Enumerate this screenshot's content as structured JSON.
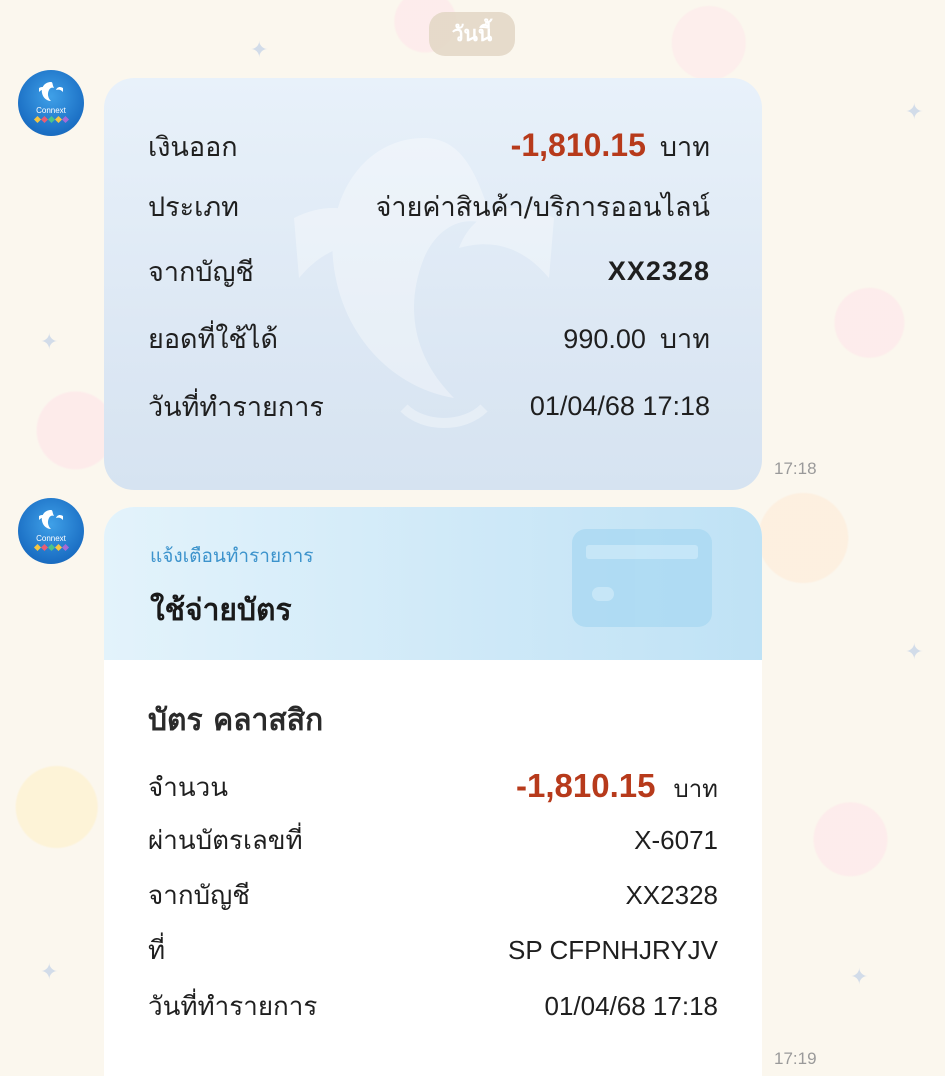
{
  "chat": {
    "date_label": "วันนี้"
  },
  "sender": {
    "avatar_label": "Connext"
  },
  "message1": {
    "rows": [
      {
        "label": "เงินออก",
        "value": "-1,810.15",
        "unit": "บาท"
      },
      {
        "label": "ประเภท",
        "value": "จ่ายค่าสินค้า/บริการออนไลน์"
      },
      {
        "label": "จากบัญชี",
        "value": "XX2328"
      },
      {
        "label": "ยอดที่ใช้ได้",
        "value": "990.00",
        "unit": "บาท"
      },
      {
        "label": "วันที่ทำรายการ",
        "value": "01/04/68 17:18"
      }
    ],
    "time": "17:18"
  },
  "message2": {
    "subtitle": "แจ้งเตือนทำรายการ",
    "title": "ใช้จ่ายบัตร",
    "card_name": "บัตร คลาสสิก",
    "rows": [
      {
        "label": "จำนวน",
        "value": "-1,810.15",
        "unit": "บาท"
      },
      {
        "label": "ผ่านบัตรเลขที่",
        "value": "X-6071"
      },
      {
        "label": "จากบัญชี",
        "value": "XX2328"
      },
      {
        "label": "ที่",
        "value": "SP CFPNHJRYJV"
      },
      {
        "label": "วันที่ทำรายการ",
        "value": "01/04/68 17:18"
      }
    ],
    "time": "17:19"
  },
  "colors": {
    "amount": "#b73a1b",
    "subtitle": "#3c93cc",
    "avatar": "#1b6fc4"
  }
}
